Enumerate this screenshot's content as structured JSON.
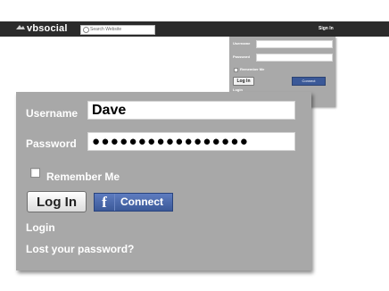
{
  "header": {
    "logo_text": "vbsocial",
    "search_placeholder": "Search Website",
    "sign_in": "Sign In"
  },
  "mini_panel": {
    "username_label": "Username",
    "password_label": "Password",
    "remember_label": "Remember Me",
    "login_button": "Log In",
    "connect_button": "Connect",
    "login_link": "Login"
  },
  "login_panel": {
    "username_label": "Username",
    "username_value": "Dave",
    "password_label": "Password",
    "password_value": "●●●●●●●●●●●●●●●●●",
    "remember_label": "Remember Me",
    "remember_checked": false,
    "login_button": "Log In",
    "connect_icon": "f",
    "connect_button": "Connect",
    "login_link": "Login",
    "lost_password_link": "Lost your password?"
  },
  "colors": {
    "topbar": "#2b2b2b",
    "panel": "#a8a8a8",
    "facebook": "#3b5998"
  }
}
